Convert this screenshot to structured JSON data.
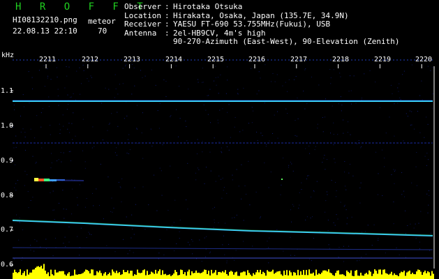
{
  "header": {
    "brand": "H R O F F T",
    "filename": "HI08132210.png",
    "event_type": "meteor",
    "datetime": "22.08.13 22:10",
    "count": "70"
  },
  "station": [
    {
      "key": "Observer",
      "value": "Hirotaka Otsuka"
    },
    {
      "key": "Location",
      "value": "Hirakata, Osaka, Japan (135.7E, 34.9N)"
    },
    {
      "key": "Receiver",
      "value": "YAESU FT-690 53.755MHz(Fukui), USB"
    },
    {
      "key": "Antenna",
      "value": "2el-HB9CV, 4m's high"
    },
    {
      "key": "",
      "value": "90-270-Azimuth (East-West), 90-Elevation (Zenith)"
    }
  ],
  "spectrogram": {
    "freq_unit": "kHz",
    "freq_ticks": [
      "1.1",
      "1.0",
      "0.9",
      "0.8",
      "0.7",
      "0.6"
    ],
    "time_ticks": [
      "2211",
      "2212",
      "2213",
      "2214",
      "2215",
      "2216",
      "2217",
      "2218",
      "2219",
      "2220"
    ],
    "colors": {
      "background": "#000000",
      "tick_text": "#ffffff",
      "carrier": "#40e0ff",
      "noise": "#1a2aa0",
      "power_bar": "#ffff00"
    }
  }
}
